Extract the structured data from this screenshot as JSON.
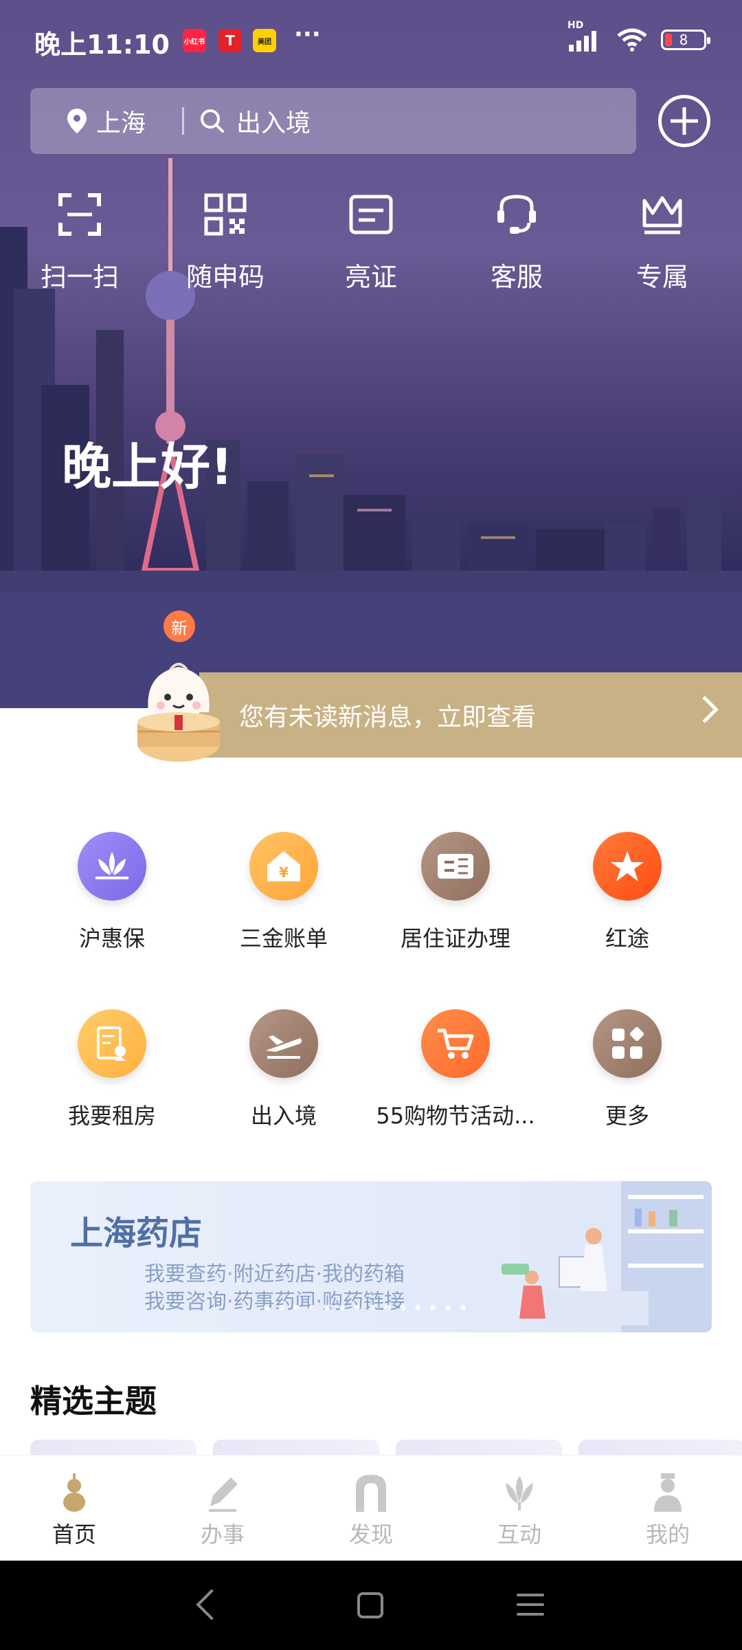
{
  "status_bar": {
    "time": "晚上11:10",
    "apps": [
      "小红书",
      "T",
      "美团"
    ],
    "more": "···",
    "network": "HD",
    "battery": "8",
    "colors": {
      "xiaohongshu": "#ff2442",
      "tesla": "#e82127",
      "meituan": "#ffd100"
    }
  },
  "search": {
    "city": "上海",
    "placeholder": "出入境"
  },
  "quick_actions": [
    {
      "label": "扫一扫",
      "icon": "scan-icon"
    },
    {
      "label": "随申码",
      "icon": "qr-code-icon"
    },
    {
      "label": "亮证",
      "icon": "id-card-icon"
    },
    {
      "label": "客服",
      "icon": "customer-service-icon"
    },
    {
      "label": "专属",
      "icon": "crown-icon"
    }
  ],
  "greeting": "晚上好!",
  "notification": {
    "badge": "新",
    "text": "您有未读新消息，立即查看"
  },
  "services": [
    {
      "label": "沪惠保",
      "icon": "lotus-icon",
      "color": "#8a79f0"
    },
    {
      "label": "三金账单",
      "icon": "house-yuan-icon",
      "color": "#ffb347"
    },
    {
      "label": "居住证办理",
      "icon": "residence-card-icon",
      "color": "#a0806c"
    },
    {
      "label": "红途",
      "icon": "star-icon",
      "color": "#ff5a1f"
    },
    {
      "label": "我要租房",
      "icon": "rent-document-icon",
      "color": "#ffbe4d"
    },
    {
      "label": "出入境",
      "icon": "airplane-icon",
      "color": "#a0806c"
    },
    {
      "label": "55购物节活动...",
      "icon": "cart-icon",
      "color": "#ff7a33"
    },
    {
      "label": "更多",
      "icon": "more-grid-icon",
      "color": "#a0806c"
    }
  ],
  "banner": {
    "title": "上海药店",
    "line1": "我要查药·附近药店·我的药箱",
    "line2": "我要咨询·药事药闻·购药链接"
  },
  "section_title": "精选主题",
  "tabs": [
    {
      "label": "首页",
      "icon": "gourd-icon",
      "active": true
    },
    {
      "label": "办事",
      "icon": "pen-icon",
      "active": false
    },
    {
      "label": "发现",
      "icon": "arch-icon",
      "active": false
    },
    {
      "label": "互动",
      "icon": "magnolia-icon",
      "active": false
    },
    {
      "label": "我的",
      "icon": "person-icon",
      "active": false
    }
  ]
}
